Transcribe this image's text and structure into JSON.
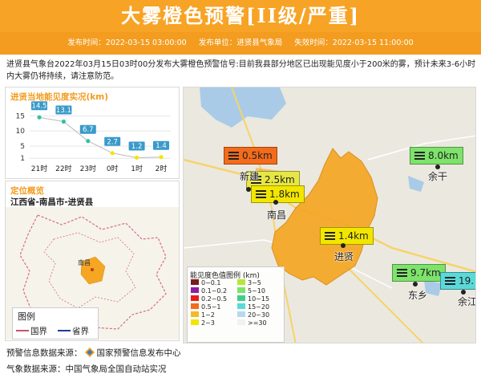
{
  "header": {
    "title": "大雾橙色预警[II级/严重]",
    "publish_time": "发布时间：2022-03-15 03:00:00",
    "publisher": "发布单位：进贤县气象局",
    "expire_time": "失效时间：2022-03-15 11:00:00"
  },
  "description": "进贤县气象台2022年03月15日03时00分发布大雾橙色预警信号:目前我县部分地区已出现能见度小于200米的雾，预计未来3-6小时内大雾仍将持续，请注意防范。",
  "visibility_panel": {
    "title": "进贤当地能见度实况(km)"
  },
  "chart_data": {
    "type": "line",
    "title": "进贤当地能见度实况(km)",
    "categories": [
      "21时",
      "22时",
      "23时",
      "0时",
      "1时",
      "2时"
    ],
    "values": [
      14.5,
      13.1,
      6.7,
      2.7,
      1.2,
      1.4
    ],
    "point_colors": [
      "#2ec4a0",
      "#2ec4a0",
      "#2ec4a0",
      "#f2e600",
      "#f2e600",
      "#f2e600"
    ],
    "label_color": "#3a9ac9",
    "yticks": [
      1,
      5,
      10,
      15
    ],
    "ylim": [
      0,
      18
    ],
    "grid": true
  },
  "location_panel": {
    "title": "定位概览",
    "region": "江西省-南昌市-进贤县",
    "city_label": "南昌",
    "legend_title": "图例",
    "legend_items": [
      {
        "label": "国界",
        "color": "#c5546a"
      },
      {
        "label": "省界",
        "color": "#1f3a9e"
      }
    ]
  },
  "map": {
    "stations": [
      {
        "value": "0.5km",
        "color": "#f36b1b"
      },
      {
        "value": "2.5km",
        "color": "#e6e645"
      },
      {
        "value": "1.8km",
        "color": "#f2e600"
      },
      {
        "value": "1.4km",
        "color": "#f2e600"
      },
      {
        "value": "8.0km",
        "color": "#7de36a"
      },
      {
        "value": "9.7km",
        "color": "#7de36a"
      },
      {
        "value": "19.",
        "color": "#5ad9d9"
      }
    ],
    "cities": [
      "新建",
      "南昌",
      "进贤",
      "余干",
      "东乡",
      "余江"
    ],
    "legend": {
      "title": "能见度色值图例 (km)",
      "items": [
        {
          "label": "0~0.1",
          "color": "#7a1c1c"
        },
        {
          "label": "0.1~0.2",
          "color": "#8c1fa0"
        },
        {
          "label": "0.2~0.5",
          "color": "#e81d1d"
        },
        {
          "label": "0.5~1",
          "color": "#f36b1b"
        },
        {
          "label": "1~2",
          "color": "#f2b92a"
        },
        {
          "label": "2~3",
          "color": "#f2e600"
        },
        {
          "label": "3~5",
          "color": "#b8e636"
        },
        {
          "label": "5~10",
          "color": "#7de36a"
        },
        {
          "label": "10~15",
          "color": "#3ed08a"
        },
        {
          "label": "15~20",
          "color": "#5ad9d9"
        },
        {
          "label": "20~30",
          "color": "#b7d9ee"
        },
        {
          "label": ">=30",
          "color": "#f2f2f2"
        }
      ]
    }
  },
  "footer": {
    "source1_label": "预警信息数据来源：",
    "source1_value": "国家预警信息发布中心",
    "source2": "气象数据来源：中国气象局全国自动站实况"
  }
}
